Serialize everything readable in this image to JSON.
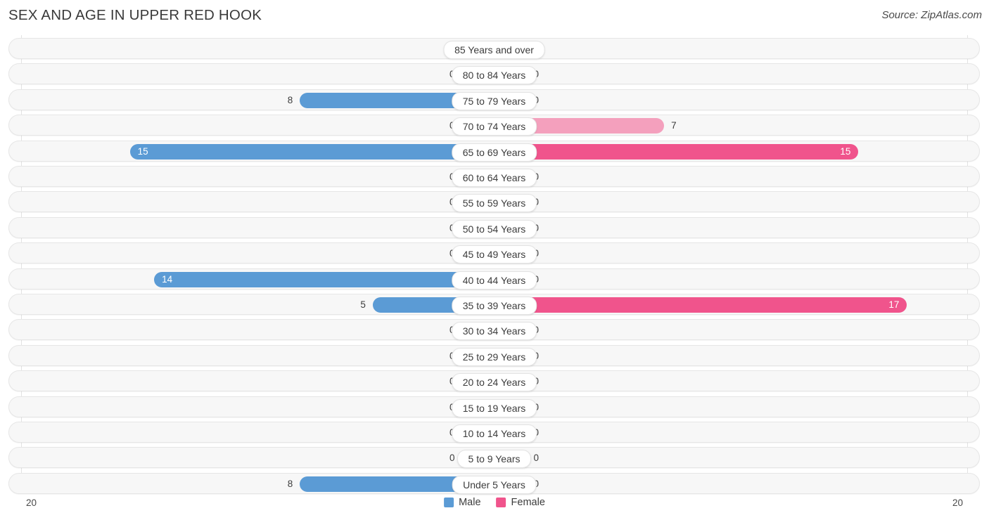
{
  "header": {
    "title": "SEX AND AGE IN UPPER RED HOOK",
    "source": "Source: ZipAtlas.com"
  },
  "axis": {
    "left_max_label": "20",
    "right_max_label": "20"
  },
  "legend": {
    "male": {
      "label": "Male",
      "color": "#5b9bd5"
    },
    "female": {
      "label": "Female",
      "color": "#f0548c"
    }
  },
  "colors": {
    "male_strong": "#5b9bd5",
    "male_light": "#a8c8ea",
    "female_strong": "#f0548c",
    "female_light": "#f4a0bd",
    "row_track": "#f7f7f7",
    "row_border": "#e6e6e6",
    "pill_bg": "#ffffff"
  },
  "chart_data": {
    "type": "bar",
    "subtype": "population-pyramid",
    "title": "SEX AND AGE IN UPPER RED HOOK",
    "xlabel": "",
    "ylabel": "",
    "xlim": [
      20,
      20
    ],
    "axis_max": 20,
    "grid": false,
    "legend_position": "bottom-center",
    "categories": [
      "85 Years and over",
      "80 to 84 Years",
      "75 to 79 Years",
      "70 to 74 Years",
      "65 to 69 Years",
      "60 to 64 Years",
      "55 to 59 Years",
      "50 to 54 Years",
      "45 to 49 Years",
      "40 to 44 Years",
      "35 to 39 Years",
      "30 to 34 Years",
      "25 to 29 Years",
      "20 to 24 Years",
      "15 to 19 Years",
      "10 to 14 Years",
      "5 to 9 Years",
      "Under 5 Years"
    ],
    "series": [
      {
        "name": "Male",
        "color": "#5b9bd5",
        "values": [
          0,
          0,
          8,
          0,
          15,
          0,
          0,
          0,
          0,
          14,
          5,
          0,
          0,
          0,
          0,
          0,
          0,
          8
        ]
      },
      {
        "name": "Female",
        "color": "#f0548c",
        "values": [
          0,
          0,
          0,
          7,
          15,
          0,
          0,
          0,
          0,
          0,
          17,
          0,
          0,
          0,
          0,
          0,
          0,
          0
        ]
      }
    ]
  },
  "rows": [
    {
      "age": "85 Years and over",
      "male": 0,
      "male_text": "0",
      "female": 0,
      "female_text": "0"
    },
    {
      "age": "80 to 84 Years",
      "male": 0,
      "male_text": "0",
      "female": 0,
      "female_text": "0"
    },
    {
      "age": "75 to 79 Years",
      "male": 8,
      "male_text": "8",
      "female": 0,
      "female_text": "0"
    },
    {
      "age": "70 to 74 Years",
      "male": 0,
      "male_text": "0",
      "female": 7,
      "female_text": "7"
    },
    {
      "age": "65 to 69 Years",
      "male": 15,
      "male_text": "15",
      "female": 15,
      "female_text": "15"
    },
    {
      "age": "60 to 64 Years",
      "male": 0,
      "male_text": "0",
      "female": 0,
      "female_text": "0"
    },
    {
      "age": "55 to 59 Years",
      "male": 0,
      "male_text": "0",
      "female": 0,
      "female_text": "0"
    },
    {
      "age": "50 to 54 Years",
      "male": 0,
      "male_text": "0",
      "female": 0,
      "female_text": "0"
    },
    {
      "age": "45 to 49 Years",
      "male": 0,
      "male_text": "0",
      "female": 0,
      "female_text": "0"
    },
    {
      "age": "40 to 44 Years",
      "male": 14,
      "male_text": "14",
      "female": 0,
      "female_text": "0"
    },
    {
      "age": "35 to 39 Years",
      "male": 5,
      "male_text": "5",
      "female": 17,
      "female_text": "17"
    },
    {
      "age": "30 to 34 Years",
      "male": 0,
      "male_text": "0",
      "female": 0,
      "female_text": "0"
    },
    {
      "age": "25 to 29 Years",
      "male": 0,
      "male_text": "0",
      "female": 0,
      "female_text": "0"
    },
    {
      "age": "20 to 24 Years",
      "male": 0,
      "male_text": "0",
      "female": 0,
      "female_text": "0"
    },
    {
      "age": "15 to 19 Years",
      "male": 0,
      "male_text": "0",
      "female": 0,
      "female_text": "0"
    },
    {
      "age": "10 to 14 Years",
      "male": 0,
      "male_text": "0",
      "female": 0,
      "female_text": "0"
    },
    {
      "age": "5 to 9 Years",
      "male": 0,
      "male_text": "0",
      "female": 0,
      "female_text": "0"
    },
    {
      "age": "Under 5 Years",
      "male": 8,
      "male_text": "8",
      "female": 0,
      "female_text": "0"
    }
  ]
}
